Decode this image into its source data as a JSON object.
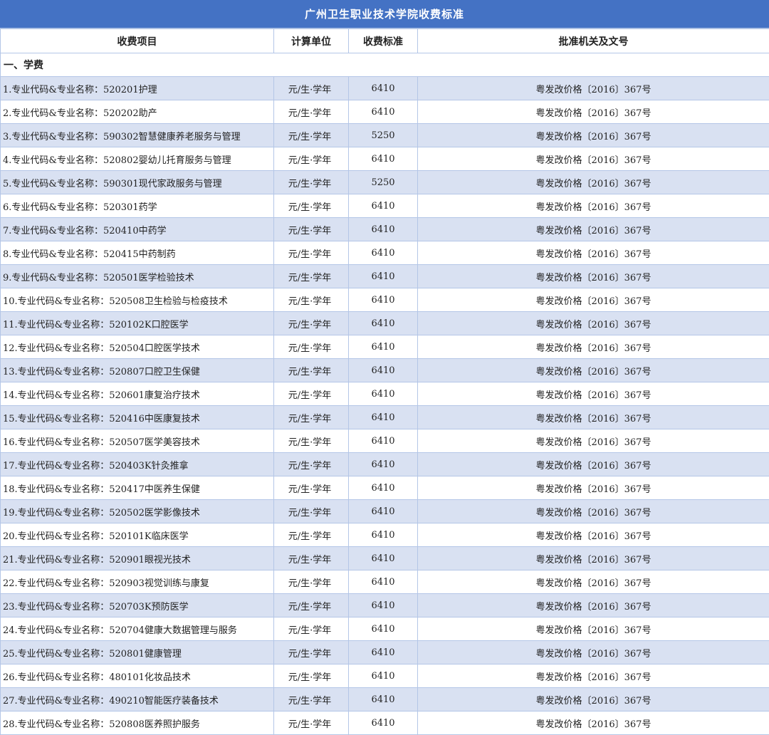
{
  "title": "广州卫生职业技术学院收费标准",
  "columns": [
    "收费项目",
    "计算单位",
    "收费标准",
    "批准机关及文号"
  ],
  "section_title": "一、学费",
  "colors": {
    "header_bg": "#4472c4",
    "alt_row_bg": "#d9e1f2",
    "border": "#b4c6e7"
  },
  "rows": [
    {
      "name": "1.专业代码&专业名称：520201护理",
      "unit": "元/生·学年",
      "std": "6410",
      "approval": "粤发改价格〔2016〕367号"
    },
    {
      "name": "2.专业代码&专业名称：520202助产",
      "unit": "元/生·学年",
      "std": "6410",
      "approval": "粤发改价格〔2016〕367号"
    },
    {
      "name": "3.专业代码&专业名称：590302智慧健康养老服务与管理",
      "unit": "元/生·学年",
      "std": "5250",
      "approval": "粤发改价格〔2016〕367号"
    },
    {
      "name": "4.专业代码&专业名称：520802婴幼儿托育服务与管理",
      "unit": "元/生·学年",
      "std": "6410",
      "approval": "粤发改价格〔2016〕367号"
    },
    {
      "name": "5.专业代码&专业名称：590301现代家政服务与管理",
      "unit": "元/生·学年",
      "std": "5250",
      "approval": "粤发改价格〔2016〕367号"
    },
    {
      "name": "6.专业代码&专业名称：520301药学",
      "unit": "元/生·学年",
      "std": "6410",
      "approval": "粤发改价格〔2016〕367号"
    },
    {
      "name": "7.专业代码&专业名称：520410中药学",
      "unit": "元/生·学年",
      "std": "6410",
      "approval": "粤发改价格〔2016〕367号"
    },
    {
      "name": "8.专业代码&专业名称：520415中药制药",
      "unit": "元/生·学年",
      "std": "6410",
      "approval": "粤发改价格〔2016〕367号"
    },
    {
      "name": "9.专业代码&专业名称：520501医学检验技术",
      "unit": "元/生·学年",
      "std": "6410",
      "approval": "粤发改价格〔2016〕367号"
    },
    {
      "name": "10.专业代码&专业名称：520508卫生检验与检疫技术",
      "unit": "元/生·学年",
      "std": "6410",
      "approval": "粤发改价格〔2016〕367号"
    },
    {
      "name": "11.专业代码&专业名称：520102K口腔医学",
      "unit": "元/生·学年",
      "std": "6410",
      "approval": "粤发改价格〔2016〕367号"
    },
    {
      "name": "12.专业代码&专业名称：520504口腔医学技术",
      "unit": "元/生·学年",
      "std": "6410",
      "approval": "粤发改价格〔2016〕367号"
    },
    {
      "name": "13.专业代码&专业名称：520807口腔卫生保健",
      "unit": "元/生·学年",
      "std": "6410",
      "approval": "粤发改价格〔2016〕367号"
    },
    {
      "name": "14.专业代码&专业名称：520601康复治疗技术",
      "unit": "元/生·学年",
      "std": "6410",
      "approval": "粤发改价格〔2016〕367号"
    },
    {
      "name": "15.专业代码&专业名称：520416中医康复技术",
      "unit": "元/生·学年",
      "std": "6410",
      "approval": "粤发改价格〔2016〕367号"
    },
    {
      "name": "16.专业代码&专业名称：520507医学美容技术",
      "unit": "元/生·学年",
      "std": "6410",
      "approval": "粤发改价格〔2016〕367号"
    },
    {
      "name": "17.专业代码&专业名称：520403K针灸推拿",
      "unit": "元/生·学年",
      "std": "6410",
      "approval": "粤发改价格〔2016〕367号"
    },
    {
      "name": "18.专业代码&专业名称：520417中医养生保健",
      "unit": "元/生·学年",
      "std": "6410",
      "approval": "粤发改价格〔2016〕367号"
    },
    {
      "name": "19.专业代码&专业名称：520502医学影像技术",
      "unit": "元/生·学年",
      "std": "6410",
      "approval": "粤发改价格〔2016〕367号"
    },
    {
      "name": "20.专业代码&专业名称：520101K临床医学",
      "unit": "元/生·学年",
      "std": "6410",
      "approval": "粤发改价格〔2016〕367号"
    },
    {
      "name": "21.专业代码&专业名称：520901眼视光技术",
      "unit": "元/生·学年",
      "std": "6410",
      "approval": "粤发改价格〔2016〕367号"
    },
    {
      "name": "22.专业代码&专业名称：520903视觉训练与康复",
      "unit": "元/生·学年",
      "std": "6410",
      "approval": "粤发改价格〔2016〕367号"
    },
    {
      "name": "23.专业代码&专业名称：520703K预防医学",
      "unit": "元/生·学年",
      "std": "6410",
      "approval": "粤发改价格〔2016〕367号"
    },
    {
      "name": "24.专业代码&专业名称：520704健康大数据管理与服务",
      "unit": "元/生·学年",
      "std": "6410",
      "approval": "粤发改价格〔2016〕367号"
    },
    {
      "name": "25.专业代码&专业名称：520801健康管理",
      "unit": "元/生·学年",
      "std": "6410",
      "approval": "粤发改价格〔2016〕367号"
    },
    {
      "name": "26.专业代码&专业名称：480101化妆品技术",
      "unit": "元/生·学年",
      "std": "6410",
      "approval": "粤发改价格〔2016〕367号"
    },
    {
      "name": "27.专业代码&专业名称：490210智能医疗装备技术",
      "unit": "元/生·学年",
      "std": "6410",
      "approval": "粤发改价格〔2016〕367号"
    },
    {
      "name": "28.专业代码&专业名称：520808医养照护服务",
      "unit": "元/生·学年",
      "std": "6410",
      "approval": "粤发改价格〔2016〕367号"
    }
  ]
}
